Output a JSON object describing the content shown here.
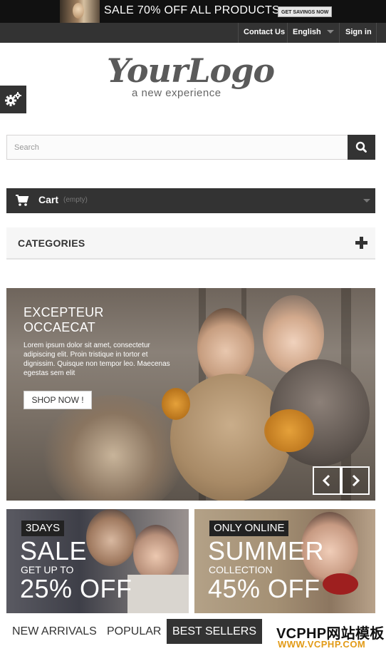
{
  "promo_banner": {
    "text": "SALE 70% OFF ALL PRODUCTS",
    "button_label": "GET SAVINGS NOW"
  },
  "top_nav": {
    "contact_label": "Contact Us",
    "language_label": "English",
    "signin_label": "Sign in"
  },
  "logo": {
    "title": "YourLogo",
    "tagline": "a new experience"
  },
  "settings": {
    "icon": "gears-icon"
  },
  "search": {
    "placeholder": "Search",
    "value": "",
    "button_icon": "search-icon"
  },
  "cart": {
    "label": "Cart",
    "status": "(empty)",
    "icon": "cart-icon"
  },
  "categories": {
    "label": "CATEGORIES",
    "icon": "plus-icon"
  },
  "slider": {
    "heading_line1": "EXCEPTEUR",
    "heading_line2": "OCCAECAT",
    "copy": "Lorem ipsum dolor sit amet, consectetur adipiscing elit. Proin tristique in tortor et dignissim. Quisque non tempor leo. Maecenas egestas sem elit",
    "button_label": "SHOP NOW !",
    "prev_icon": "chevron-left-icon",
    "next_icon": "chevron-right-icon"
  },
  "tiles": [
    {
      "tag": "3DAYS",
      "headline": "SALE",
      "subline": "GET UP TO",
      "amount": "25% OFF"
    },
    {
      "tag": "ONLY ONLINE",
      "headline": "SUMMER",
      "subline": "COLLECTION",
      "amount": "45% OFF"
    }
  ],
  "product_tabs": [
    {
      "label": "NEW ARRIVALS",
      "active": false
    },
    {
      "label": "POPULAR",
      "active": false
    },
    {
      "label": "BEST SELLERS",
      "active": true
    }
  ],
  "watermark": {
    "title": "VCPHP网站模板",
    "url": "WWW.VCPHP.COM"
  },
  "colors": {
    "dark": "#333333",
    "promo_bg": "#111111",
    "watermark_url": "#e29a16"
  }
}
